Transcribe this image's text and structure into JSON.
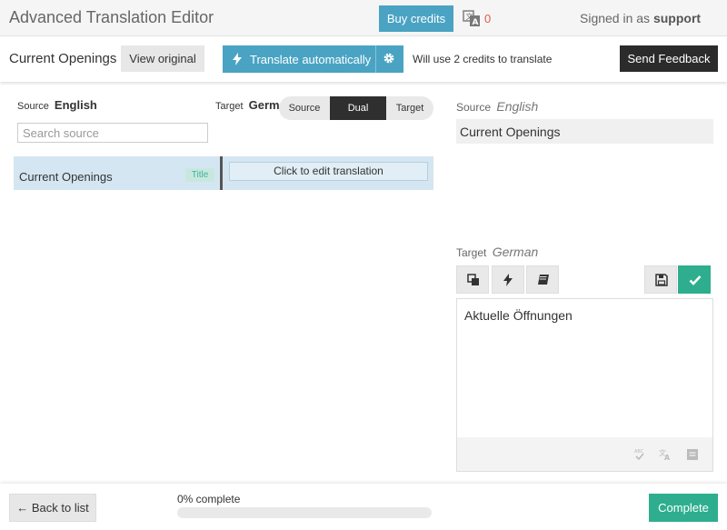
{
  "header": {
    "title": "Advanced Translation Editor",
    "buy_credits_label": "Buy credits",
    "credits_count": "0",
    "signed_in_prefix": "Signed in as",
    "username": "support"
  },
  "toolbar": {
    "page_name": "Current Openings",
    "view_original_label": "View original",
    "translate_auto_label": "Translate automatically",
    "credit_note": "Will use 2 credits to translate",
    "send_feedback_label": "Send Feedback"
  },
  "list": {
    "source_prefix": "Source",
    "source_language": "English",
    "target_prefix": "Target",
    "target_language": "German",
    "view_modes": [
      "Source",
      "Dual",
      "Target"
    ],
    "active_mode": "Dual",
    "search_placeholder": "Search source",
    "rows": [
      {
        "source": "Current Openings",
        "badge": "Title",
        "translation_placeholder": "Click to edit translation"
      }
    ]
  },
  "detail": {
    "source_label": "Source",
    "source_language": "English",
    "source_text": "Current Openings",
    "target_label": "Target",
    "target_language": "German",
    "target_text": "Aktuelle Öffnungen"
  },
  "footer": {
    "back_label": "← Back to list",
    "progress_text": "0% complete",
    "progress_fraction": 0,
    "complete_label": "Complete"
  },
  "colors": {
    "accent": "#4aa3c3",
    "success": "#2eae8e",
    "dark": "#2b2b2b",
    "row_selected": "#d4e6f1"
  }
}
